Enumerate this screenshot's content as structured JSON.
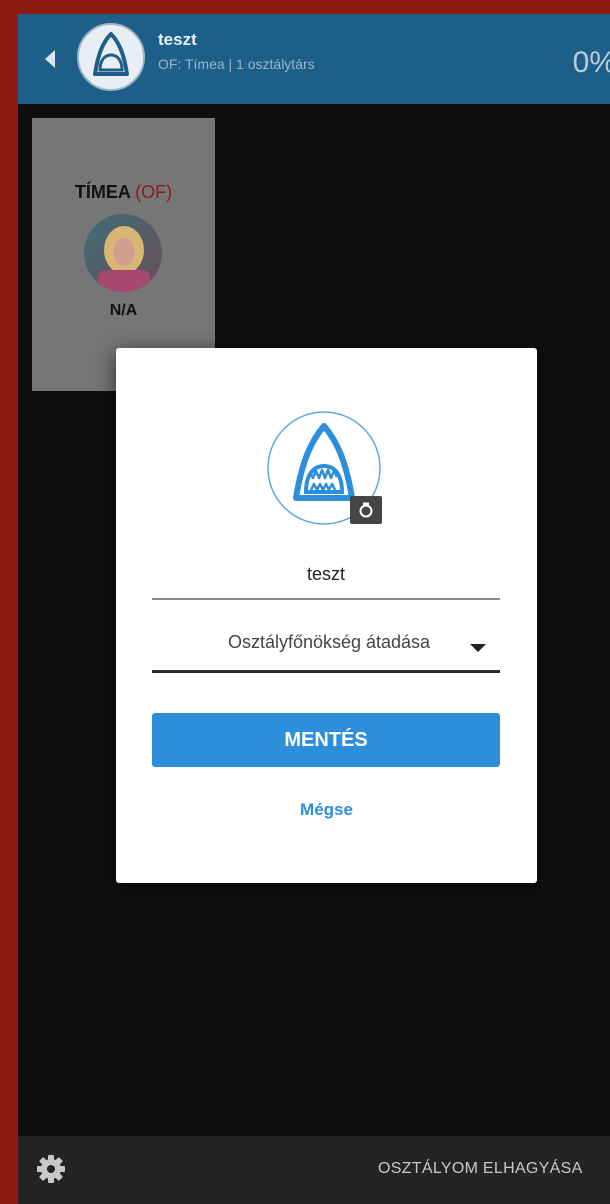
{
  "header": {
    "title": "teszt",
    "subtitle": "OF: Tímea | 1 osztálytárs",
    "progress": "0%"
  },
  "member_card": {
    "name": "TÍMEA",
    "role": "(OF)",
    "score": "N/A"
  },
  "dialog": {
    "name_value": "teszt",
    "select_value": "Osztályfőnökség átadása",
    "save_label": "MENTÉS",
    "cancel_label": "Mégse"
  },
  "footer": {
    "leave_label": "OSZTÁLYOM ELHAGYÁSA"
  },
  "icons": {
    "back": "back-arrow-icon",
    "logo": "shark-logo-icon",
    "camera": "camera-icon",
    "settings": "gear-icon",
    "dropdown": "caret-down-icon"
  },
  "colors": {
    "header": "#1e5f8a",
    "accent": "#2d8fdc",
    "frame": "#8a1a12",
    "role": "#8f1a1a"
  }
}
